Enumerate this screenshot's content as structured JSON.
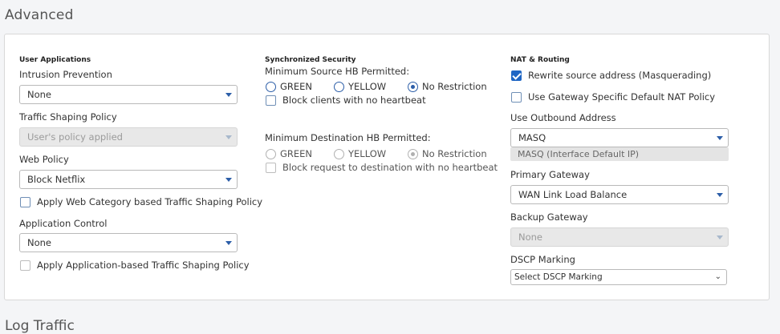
{
  "page": {
    "title": "Advanced",
    "next_section_title": "Log Traffic"
  },
  "user_apps": {
    "heading": "User Applications",
    "ips_label": "Intrusion Prevention",
    "ips_value": "None",
    "shaping_label": "Traffic Shaping Policy",
    "shaping_value": "User's policy applied",
    "web_policy_label": "Web Policy",
    "web_policy_value": "Block Netflix",
    "web_cat_shaping_label": "Apply Web Category based Traffic Shaping Policy",
    "app_control_label": "Application Control",
    "app_control_value": "None",
    "app_shaping_label": "Apply Application-based Traffic Shaping Policy"
  },
  "sync_security": {
    "heading": "Synchronized Security",
    "min_source_label": "Minimum Source HB Permitted:",
    "source_options": [
      "GREEN",
      "YELLOW",
      "No Restriction"
    ],
    "source_selected": "No Restriction",
    "block_clients_label": "Block clients with no heartbeat",
    "min_dest_label": "Minimum Destination HB Permitted:",
    "dest_options": [
      "GREEN",
      "YELLOW",
      "No Restriction"
    ],
    "dest_selected": "No Restriction",
    "block_dest_label": "Block request to destination with no heartbeat"
  },
  "nat": {
    "heading": "NAT & Routing",
    "masq_label": "Rewrite source address (Masquerading)",
    "masq_checked": true,
    "gw_nat_label": "Use Gateway Specific Default NAT Policy",
    "outbound_label": "Use Outbound Address",
    "outbound_value": "MASQ",
    "outbound_hint": "MASQ (Interface Default IP)",
    "primary_gw_label": "Primary Gateway",
    "primary_gw_value": "WAN Link Load Balance",
    "backup_gw_label": "Backup Gateway",
    "backup_gw_value": "None",
    "dscp_label": "DSCP Marking",
    "dscp_value": "Select DSCP Marking"
  },
  "colors": {
    "accent": "#2c5ea8",
    "checked": "#1f66c4",
    "disabled_bg": "#e8e8e8"
  }
}
